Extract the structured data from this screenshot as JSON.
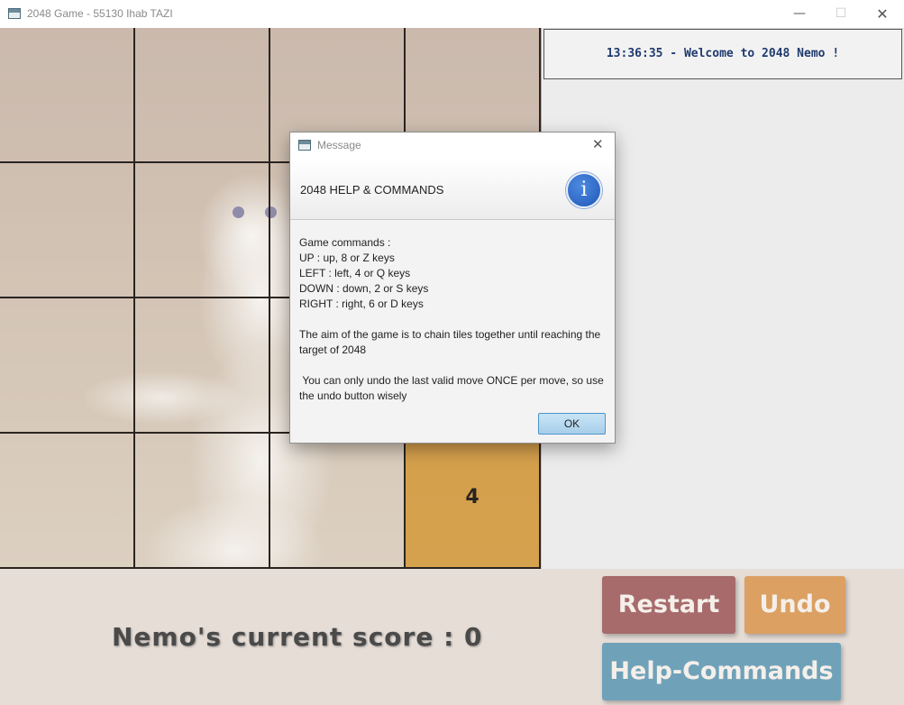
{
  "window": {
    "title": "2048 Game - 55130 Ihab TAZI",
    "minimize_glyph": "—",
    "maximize_glyph": "☐",
    "close_glyph": "✕"
  },
  "board": {
    "rows": [
      [
        "",
        "",
        "",
        ""
      ],
      [
        "",
        "",
        "",
        ""
      ],
      [
        "",
        "",
        "",
        ""
      ],
      [
        "",
        "",
        "",
        "4"
      ]
    ],
    "filled_color": "#d6962c"
  },
  "status": {
    "welcome": "13:36:35 - Welcome to 2048 Nemo !"
  },
  "score": {
    "label": "Nemo's current score : 0"
  },
  "buttons": {
    "restart": "Restart",
    "undo": "Undo",
    "help": "Help-Commands"
  },
  "colors": {
    "restart": "#a76b6b",
    "undo": "#dba062",
    "help": "#6fa2b9",
    "welcome_text": "#1f3a6e"
  },
  "dialog": {
    "title": "Message",
    "close_glyph": "✕",
    "heading": "2048 HELP & COMMANDS",
    "icon": "info-icon",
    "icon_glyph": "i",
    "lines": [
      "Game commands :",
      "UP : up, 8 or Z keys",
      "LEFT : left, 4 or Q keys",
      "DOWN : down, 2 or S keys",
      "RIGHT : right, 6 or D keys",
      "",
      "The aim of the game is to chain tiles together until reaching the target of 2048",
      "",
      " You can only undo the last valid move ONCE per move, so use the undo button wisely"
    ],
    "ok_label": "OK"
  }
}
